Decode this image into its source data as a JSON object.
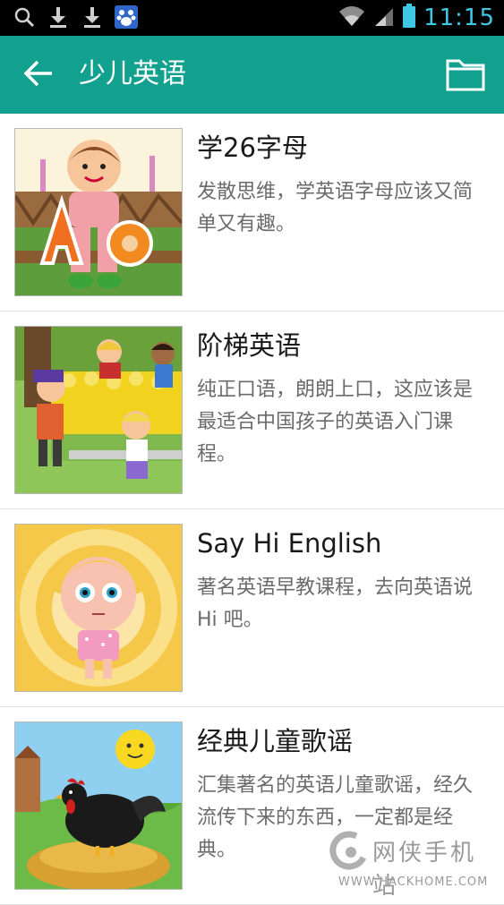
{
  "status_bar": {
    "time": "11:15",
    "icons": [
      "search-icon",
      "download-icon",
      "download-icon",
      "baidu-paw-icon",
      "wifi-icon",
      "signal-icon",
      "battery-icon"
    ]
  },
  "app_bar": {
    "title": "少儿英语",
    "back_icon": "arrow-left-icon",
    "action_icon": "folder-icon"
  },
  "colors": {
    "app_bar": "#12a08f",
    "clock": "#3ec8e6",
    "title_text": "#1a1a1a",
    "desc_text": "#6b6b6b"
  },
  "courses": [
    {
      "title": "学26字母",
      "description": "发散思维，学英语字母应该又简单又有趣。",
      "thumbnail": "cartoon-boy-letters-aa"
    },
    {
      "title": "阶梯英语",
      "description": "纯正口语，朗朗上口，这应该是最适合中国孩子的英语入门课程。",
      "thumbnail": "cartoon-kids-tulip-garden"
    },
    {
      "title": "Say Hi English",
      "description": "著名英语早教课程，去向英语说 Hi 吧。",
      "thumbnail": "cartoon-girl-yellow-rings"
    },
    {
      "title": "经典儿童歌谣",
      "description": "汇集著名的英语儿童歌谣，经久流传下来的东西，一定都是经典。",
      "thumbnail": "cartoon-rooster-haystack-sun"
    }
  ],
  "watermark": {
    "text": "网侠手机站",
    "url": "WWW.HACKHOME.COM"
  }
}
